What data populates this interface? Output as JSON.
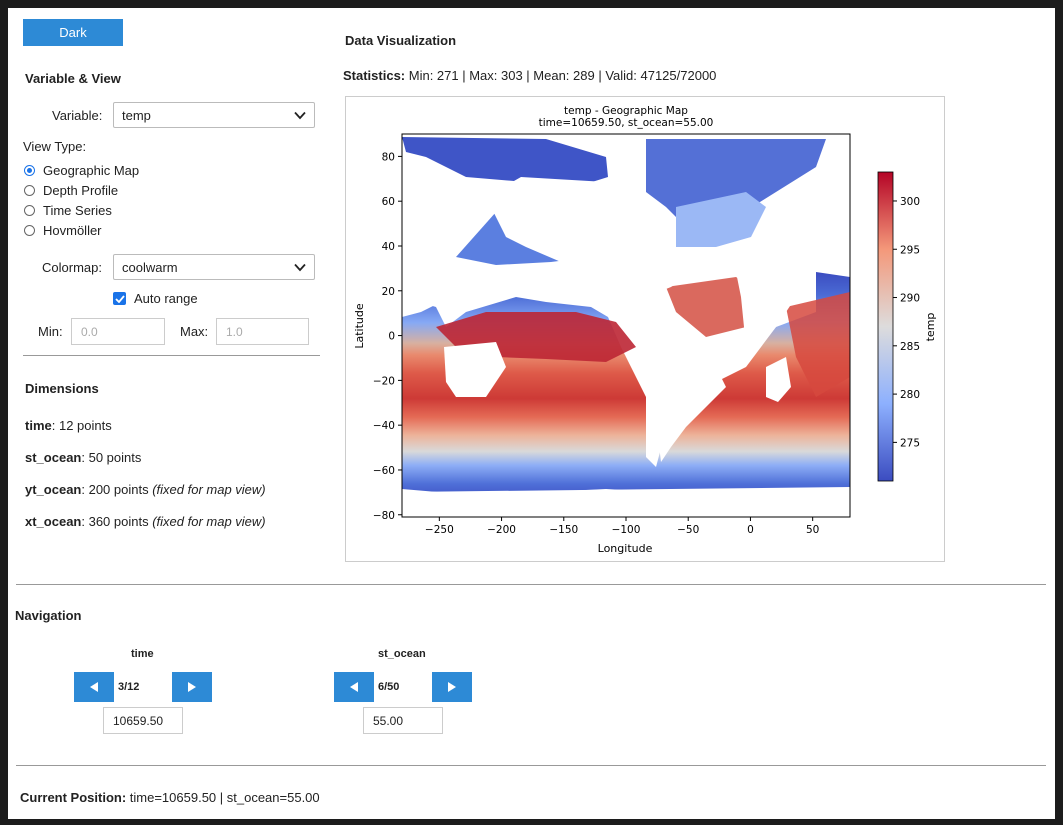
{
  "theme_button": "Dark",
  "variable_view": {
    "heading": "Variable & View",
    "variable_label": "Variable:",
    "variable_value": "temp",
    "view_type_label": "View Type:",
    "view_types": [
      {
        "label": "Geographic Map",
        "selected": true
      },
      {
        "label": "Depth Profile",
        "selected": false
      },
      {
        "label": "Time Series",
        "selected": false
      },
      {
        "label": "Hovmöller",
        "selected": false
      }
    ],
    "colormap_label": "Colormap:",
    "colormap_value": "coolwarm",
    "auto_range_label": "Auto range",
    "auto_range_checked": true,
    "min_label": "Min:",
    "min_placeholder": "0.0",
    "max_label": "Max:",
    "max_placeholder": "1.0"
  },
  "dimensions": {
    "heading": "Dimensions",
    "items": [
      {
        "name": "time",
        "text": ": 12 points",
        "note": ""
      },
      {
        "name": "st_ocean",
        "text": ": 50 points",
        "note": ""
      },
      {
        "name": "yt_ocean",
        "text": ": 200 points ",
        "note": "(fixed for map view)"
      },
      {
        "name": "xt_ocean",
        "text": ": 360 points ",
        "note": "(fixed for map view)"
      }
    ]
  },
  "visualization": {
    "heading": "Data Visualization",
    "stats_label": "Statistics:",
    "stats_value": " Min: 271 | Max: 303 | Mean: 289 | Valid: 47125/72000",
    "plot": {
      "title_line1": "temp - Geographic Map",
      "title_line2": "time=10659.50, st_ocean=55.00",
      "xlabel": "Longitude",
      "ylabel": "Latitude",
      "colorbar_label": "temp",
      "x_ticks": [
        "−250",
        "−200",
        "−150",
        "−100",
        "−50",
        "0",
        "50"
      ],
      "y_ticks": [
        "80",
        "60",
        "40",
        "20",
        "0",
        "−20",
        "−40",
        "−60",
        "−80"
      ],
      "cbar_ticks": [
        "300",
        "295",
        "290",
        "285",
        "280",
        "275"
      ]
    }
  },
  "chart_data": {
    "type": "heatmap",
    "title": "temp - Geographic Map\ntime=10659.50, st_ocean=55.00",
    "xlabel": "Longitude",
    "ylabel": "Latitude",
    "xlim": [
      -280,
      80
    ],
    "ylim": [
      -81,
      90
    ],
    "x_ticks": [
      -250,
      -200,
      -150,
      -100,
      -50,
      0,
      50
    ],
    "y_ticks": [
      80,
      60,
      40,
      20,
      0,
      -20,
      -40,
      -60,
      -80
    ],
    "colormap": "coolwarm",
    "color_range": [
      271,
      303
    ],
    "colorbar_ticks": [
      300,
      295,
      290,
      285,
      280,
      275
    ],
    "colorbar_label": "temp",
    "approximate_zonal_profile": [
      {
        "lat": 80,
        "value": 272
      },
      {
        "lat": 60,
        "value": 277
      },
      {
        "lat": 40,
        "value": 286
      },
      {
        "lat": 20,
        "value": 297
      },
      {
        "lat": 0,
        "value": 301
      },
      {
        "lat": -20,
        "value": 296
      },
      {
        "lat": -40,
        "value": 287
      },
      {
        "lat": -60,
        "value": 276
      },
      {
        "lat": -75,
        "value": 272
      }
    ]
  },
  "navigation": {
    "heading": "Navigation",
    "time": {
      "label": "time",
      "position": "3/12",
      "value": "10659.50"
    },
    "st_ocean": {
      "label": "st_ocean",
      "position": "6/50",
      "value": "55.00"
    }
  },
  "current_position": {
    "label": "Current Position:",
    "value": " time=10659.50 | st_ocean=55.00"
  }
}
